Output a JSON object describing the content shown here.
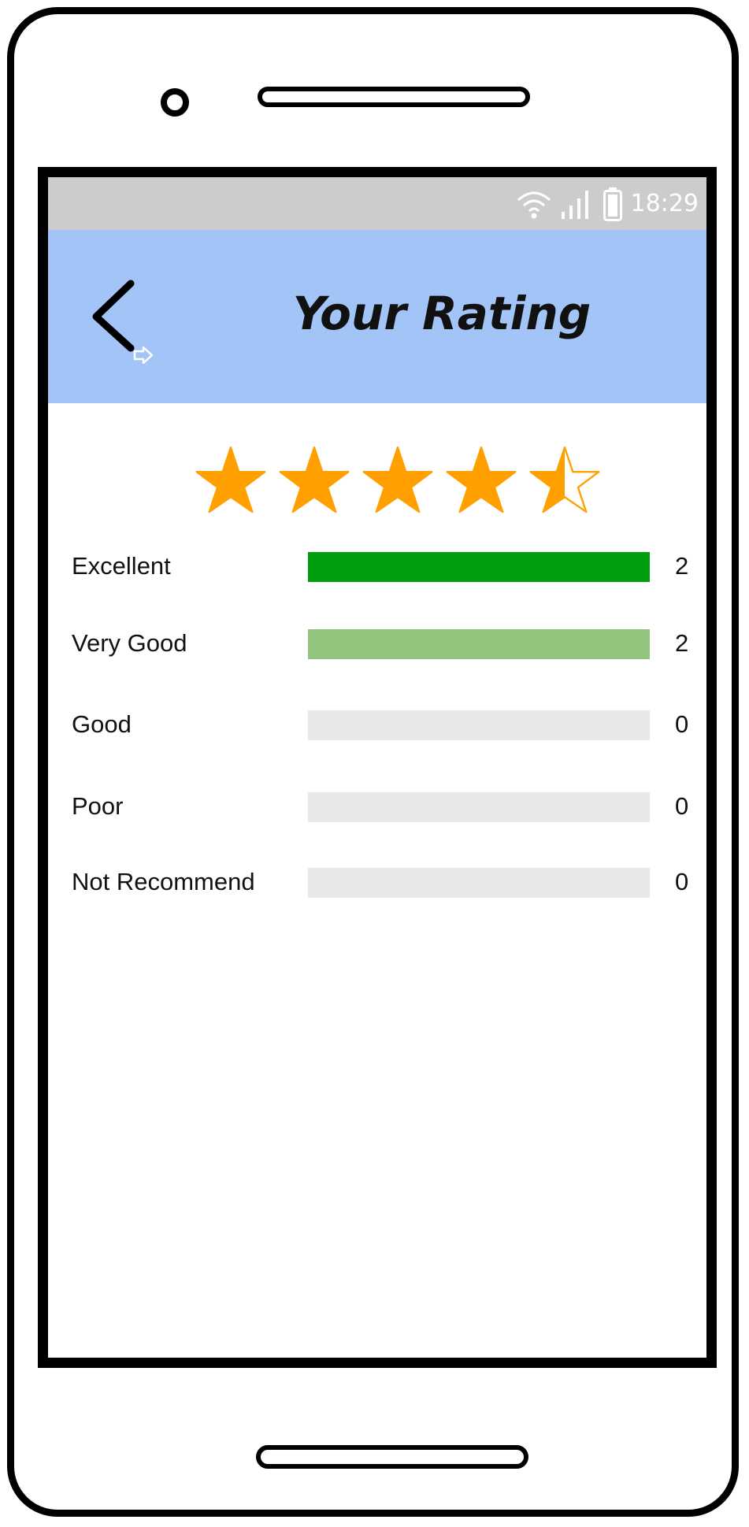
{
  "status_bar": {
    "time": "18:29",
    "icons": [
      "wifi-icon",
      "signal-icon",
      "battery-icon"
    ]
  },
  "app_bar": {
    "title": "Your Rating",
    "back_icon": "chevron-left-icon",
    "link_icon": "arrow-right-icon",
    "background": "#a2c4f6"
  },
  "stars": {
    "rating": 4.5,
    "max": 5,
    "color": "#ffa000"
  },
  "rows": [
    {
      "label": "Excellent",
      "count": "2",
      "fraction": 1.0,
      "color": "#009f0f"
    },
    {
      "label": "Very Good",
      "count": "2",
      "fraction": 1.0,
      "color": "#93c47d"
    },
    {
      "label": "Good",
      "count": "0",
      "fraction": 0,
      "color": "#e8e8e8"
    },
    {
      "label": "Poor",
      "count": "0",
      "fraction": 0,
      "color": "#e8e8e8"
    },
    {
      "label": "Not Recommend",
      "count": "0",
      "fraction": 0,
      "color": "#e8e8e8"
    }
  ]
}
